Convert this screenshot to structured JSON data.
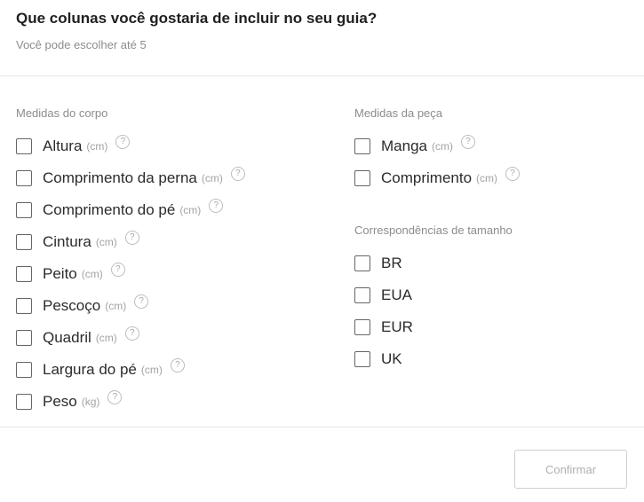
{
  "header": {
    "title": "Que colunas você gostaria de incluir no seu guia?",
    "subtitle": "Você pode escolher até 5"
  },
  "body_measures": {
    "title": "Medidas do corpo",
    "items": [
      {
        "label": "Altura",
        "unit": "(cm)",
        "checked": false
      },
      {
        "label": "Comprimento da perna",
        "unit": "(cm)",
        "checked": false
      },
      {
        "label": "Comprimento do pé",
        "unit": "(cm)",
        "checked": false
      },
      {
        "label": "Cintura",
        "unit": "(cm)",
        "checked": false
      },
      {
        "label": "Peito",
        "unit": "(cm)",
        "checked": false
      },
      {
        "label": "Pescoço",
        "unit": "(cm)",
        "checked": false
      },
      {
        "label": "Quadril",
        "unit": "(cm)",
        "checked": false
      },
      {
        "label": "Largura do pé",
        "unit": "(cm)",
        "checked": false
      },
      {
        "label": "Peso",
        "unit": "(kg)",
        "checked": false
      }
    ]
  },
  "garment_measures": {
    "title": "Medidas da peça",
    "items": [
      {
        "label": "Manga",
        "unit": "(cm)",
        "checked": false
      },
      {
        "label": "Comprimento",
        "unit": "(cm)",
        "checked": false
      }
    ]
  },
  "size_matches": {
    "title": "Correspondências de tamanho",
    "items": [
      {
        "label": "BR",
        "checked": false
      },
      {
        "label": "EUA",
        "checked": false
      },
      {
        "label": "EUR",
        "checked": false
      },
      {
        "label": "UK",
        "checked": false
      }
    ]
  },
  "help_glyph": "?",
  "footer": {
    "confirm_label": "Confirmar",
    "confirm_enabled": false
  }
}
